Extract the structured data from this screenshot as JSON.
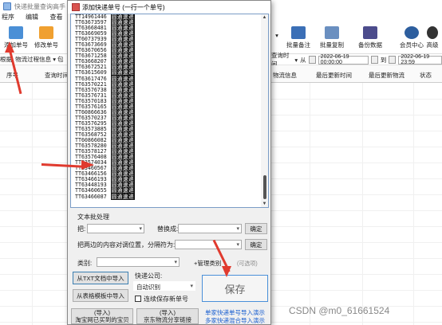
{
  "main_window": {
    "title": "快递批量查询高手",
    "title_suffix": "[哥",
    "menu": [
      "程序(F)",
      "编辑(E)",
      "查看(S)"
    ],
    "toolbar": {
      "add_label": "添加单号",
      "edit_label": "修改单号",
      "batch_note_label": "批量备注",
      "batch_copy_label": "批量复制",
      "backup_label": "备份数据",
      "member_label": "会员中心",
      "advanced_label": "高级"
    },
    "filter": {
      "left_text": "根据",
      "logistics_label": "物流过程信息",
      "by_label": "包",
      "time_label": "查询时间",
      "from_label": "从",
      "date_from": "2022-06-19 00:00:00",
      "to_label": "到",
      "date_to": "2022-06-19 23:59"
    },
    "columns": [
      "序号",
      "查询时间",
      "物流信息",
      "最后更新时间",
      "最后更新物流",
      "状态"
    ]
  },
  "dialog": {
    "title": "添加快递单号 (一行一个单号)",
    "tracking_numbers": [
      "TT14961446",
      "TT63673597",
      "TT63668481",
      "TT63669059",
      "TT60737939",
      "TT63673669",
      "TT63670656",
      "TT63671258",
      "TT63668207",
      "TT63672521",
      "TT63615609",
      "TT63617476",
      "TT63570221",
      "TT63576738",
      "TT63576731",
      "TT63570183",
      "TT63576165",
      "TT60866636",
      "TT63570237",
      "TT63576295",
      "TT63573885",
      "TT63568752",
      "TT60866082",
      "TT63578280",
      "TT63578127",
      "TT63576408",
      "TT63574034",
      "TT63460567",
      "TT63466156",
      "TT63466193",
      "TT63448193",
      "TT63460655",
      "TT63466087"
    ],
    "courier_tag": "圆通速递",
    "text_processing_label": "文本批处理",
    "replace_from_label": "把:",
    "replace_to_label": "替换成:",
    "confirm_label": "确定",
    "swap_label": "把两边的内容对调位置，分隔符为:",
    "confirm2_label": "确定",
    "category_label": "类别:",
    "manage_category_label": "+管理类别",
    "optional_label": "(可选项)",
    "import_txt_label": "从TXT文档中导入",
    "import_excel_label": "从表格模板中导入",
    "courier_company_label": "快递公司:",
    "courier_company_value": "自动识别",
    "continuous_save_label": "连续保存新单号",
    "save_label": "保存",
    "import_taobao_label": "(导入)\n淘宝网已买到的宝贝",
    "import_jd_label": "(导入)\n京东物流分享链接",
    "single_import_demo": "单家快递单号导入演示",
    "multi_import_demo": "多家快递混合导入演示"
  },
  "watermark": "CSDN @m0_61661524",
  "colors": {
    "annotation_arrow": "#e03a2e",
    "link_blue": "#1a5fd0",
    "save_border": "#4a90d9"
  }
}
